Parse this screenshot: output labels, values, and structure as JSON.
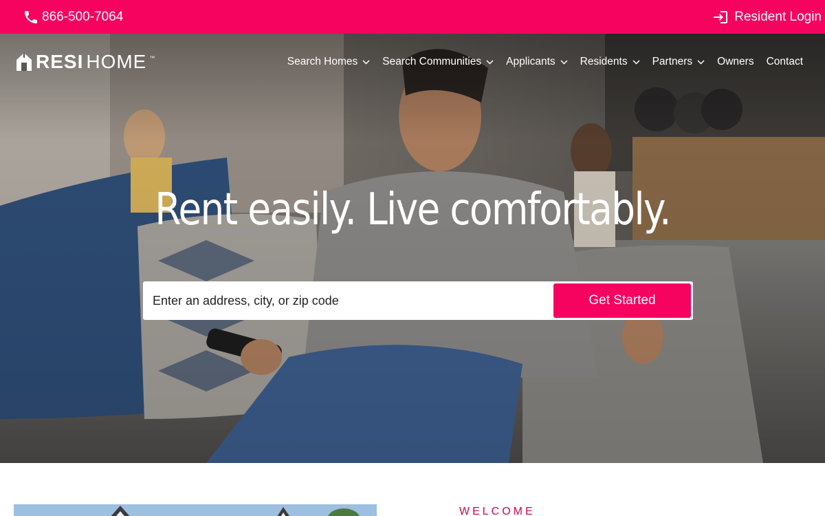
{
  "topbar": {
    "phone": "866-500-7064",
    "phone_icon": "phone-icon",
    "login_label": "Resident Login",
    "login_icon": "login-icon",
    "color": "#f5035f"
  },
  "logo": {
    "resi": "RESI",
    "home": "HOME",
    "tm": "™"
  },
  "nav": {
    "items": [
      {
        "label": "Search Homes",
        "has_dropdown": true
      },
      {
        "label": "Search Communities",
        "has_dropdown": true
      },
      {
        "label": "Applicants",
        "has_dropdown": true
      },
      {
        "label": "Residents",
        "has_dropdown": true
      },
      {
        "label": "Partners",
        "has_dropdown": true
      },
      {
        "label": "Owners",
        "has_dropdown": false
      },
      {
        "label": "Contact",
        "has_dropdown": false
      }
    ]
  },
  "hero": {
    "headline": "Rent easily. Live comfortably.",
    "search_placeholder": "Enter an address, city, or zip code",
    "search_button": "Get Started"
  },
  "welcome": {
    "label": "WELCOME"
  }
}
